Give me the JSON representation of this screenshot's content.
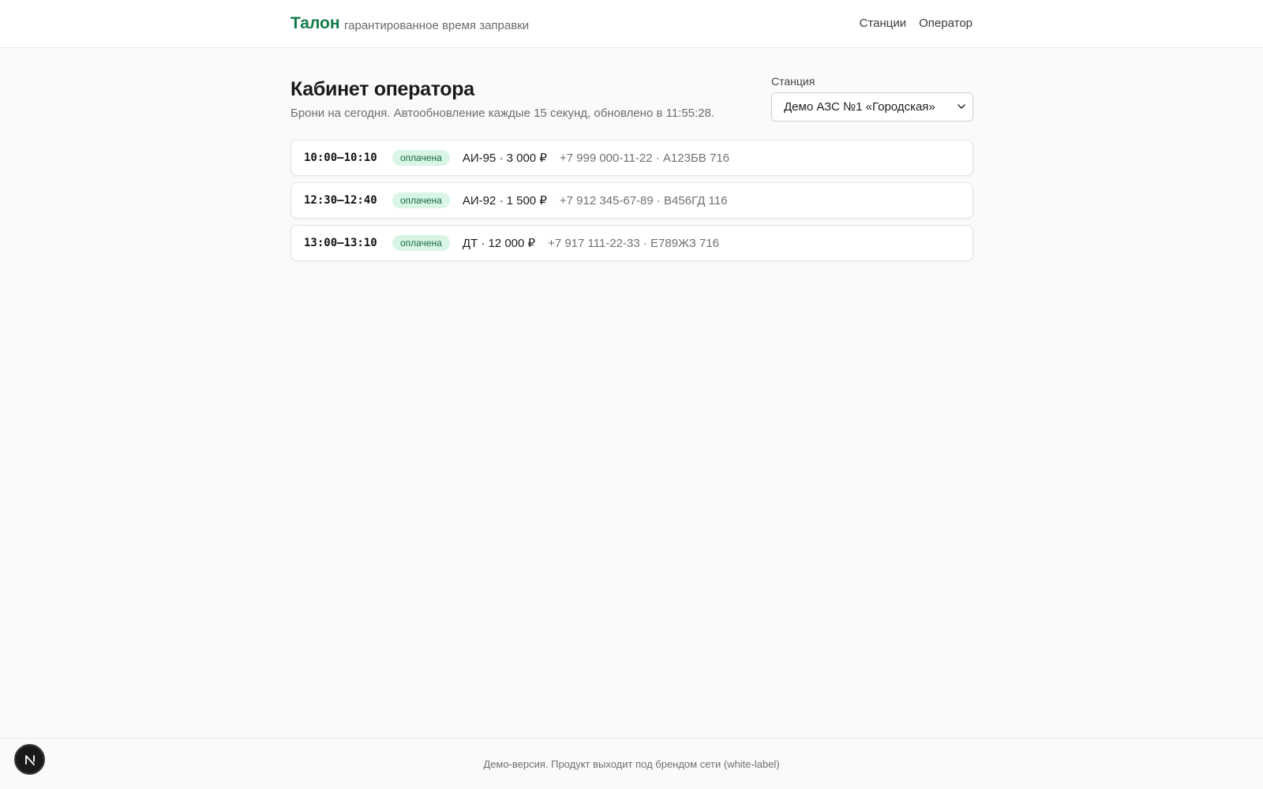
{
  "header": {
    "brand": "Талон",
    "tagline": "гарантированное время заправки",
    "nav": [
      {
        "label": "Станции"
      },
      {
        "label": "Оператор"
      }
    ]
  },
  "main": {
    "title": "Кабинет оператора",
    "subtitle": "Брони на сегодня. Автообновление каждые 15 секунд, обновлено в 11:55:28.",
    "station": {
      "label": "Станция",
      "selected": "Демо АЗС №1 «Городская»"
    },
    "bookings": [
      {
        "slot": "10:00–10:10",
        "status": "оплачена",
        "fuel": "АИ-95 · 3 000 ₽",
        "contact": "+7 999 000-11-22 · А123БВ 716"
      },
      {
        "slot": "12:30–12:40",
        "status": "оплачена",
        "fuel": "АИ-92 · 1 500 ₽",
        "contact": "+7 912 345-67-89 · В456ГД 116"
      },
      {
        "slot": "13:00–13:10",
        "status": "оплачена",
        "fuel": "ДТ · 12 000 ₽",
        "contact": "+7 917 111-22-33 · Е789ЖЗ 716"
      }
    ]
  },
  "footer": {
    "text": "Демо-версия. Продукт выходит под брендом сети (white-label)"
  },
  "dev_badge": {
    "icon": "nextjs-icon",
    "letter": "N"
  },
  "colors": {
    "brand": "#137a4b",
    "badge_bg": "#d8f5e6",
    "badge_text": "#17663f",
    "page_bg": "#fafafa"
  }
}
